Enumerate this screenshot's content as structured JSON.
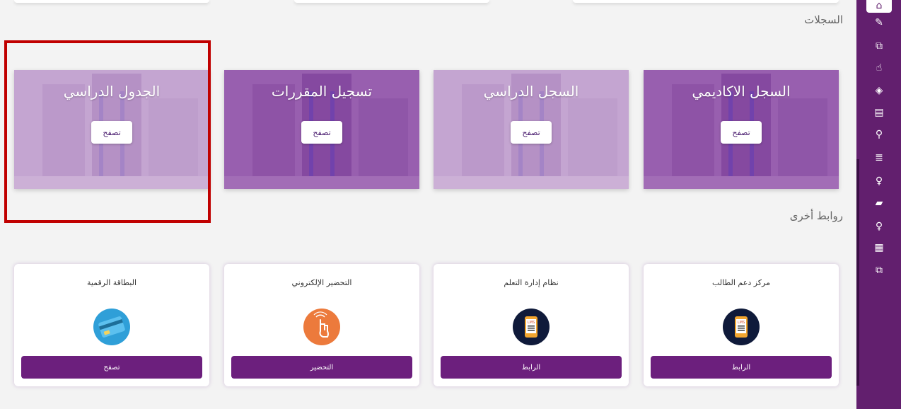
{
  "sections": {
    "records_title": "السجلات",
    "links_title": "روابط أخرى"
  },
  "record_cards": [
    {
      "title": "الجدول الدراسي",
      "button": "تصفح"
    },
    {
      "title": "تسجيل المقررات",
      "button": "تصفح"
    },
    {
      "title": "السجل الدراسي",
      "button": "تصفح"
    },
    {
      "title": "السجل الاكاديمي",
      "button": "تصفح"
    }
  ],
  "link_cards": [
    {
      "title": "البطاقة الرقمية",
      "button": "تصفح",
      "icon": "credit-card-icon"
    },
    {
      "title": "التحضير الإلكتروني",
      "button": "التحضير",
      "icon": "touch-hand-icon"
    },
    {
      "title": "نظام إدارة التعلم",
      "button": "الرابط",
      "icon": "lms-phone-icon"
    },
    {
      "title": "مركز دعم الطالب",
      "button": "الرابط",
      "icon": "lms-phone-icon"
    }
  ],
  "sidebar_icons": [
    "home-icon",
    "edit-icon",
    "frame-icon",
    "pointer-hand-icon",
    "layers-icon",
    "id-card-icon",
    "paperclip-icon",
    "server-icon",
    "lightbulb-icon",
    "book-icon",
    "lightbulb-icon",
    "calendar-icon",
    "frame-icon"
  ],
  "colors": {
    "sidebar": "#621f6e",
    "button_purple": "#6c1f7d",
    "highlight": "#c00000"
  }
}
